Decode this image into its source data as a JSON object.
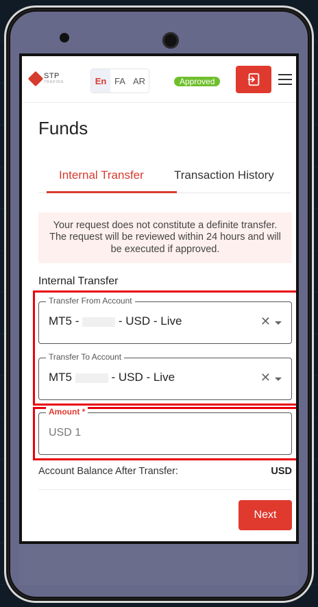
{
  "header": {
    "logo_text": "STP",
    "logo_subtext": "TRADING",
    "languages": [
      "En",
      "FA",
      "AR"
    ],
    "active_language": "En",
    "status_badge": "Approved"
  },
  "page": {
    "title": "Funds",
    "tabs": [
      {
        "label": "Internal Transfer",
        "active": true
      },
      {
        "label": "Transaction History",
        "active": false
      }
    ],
    "notice": "Your request does not constitute a definite transfer. The request will be reviewed within 24 hours and will be executed if approved.",
    "section_label": "Internal Transfer"
  },
  "form": {
    "from_account": {
      "label": "Transfer From Account",
      "value_prefix": "MT5 -",
      "value_suffix": "- USD - Live"
    },
    "to_account": {
      "label": "Transfer To Account",
      "value_prefix": "MT5",
      "value_suffix": "- USD - Live"
    },
    "amount": {
      "label": "Amount *",
      "value": "USD 1"
    },
    "balance_label": "Account Balance After Transfer:",
    "balance_currency": "USD",
    "next_label": "Next"
  },
  "colors": {
    "accent": "#e0392e",
    "badge": "#6fbf2c",
    "highlight": "#e8000b"
  }
}
